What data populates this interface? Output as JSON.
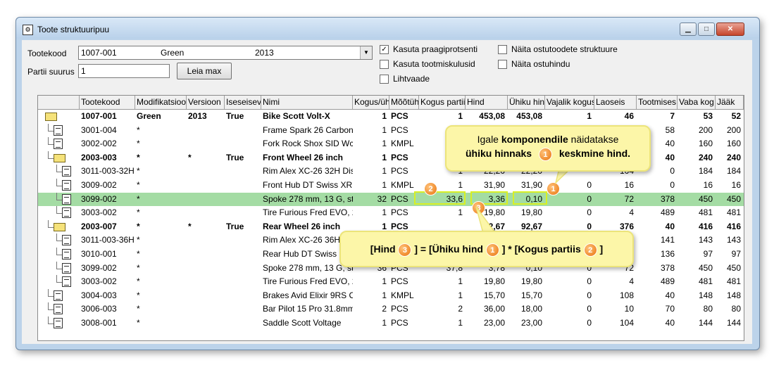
{
  "window": {
    "title": "Toote struktuuripuu",
    "icon": "gear-grid-icon"
  },
  "form": {
    "tootekood_label": "Tootekood",
    "tootekood_value": "1007-001",
    "modification": "Green",
    "version": "2013",
    "partii_label": "Partii suurus",
    "partii_value": "1",
    "find_button": "Leia max"
  },
  "options": [
    {
      "label": "Kasuta praagiprotsenti",
      "checked": true
    },
    {
      "label": "Kasuta tootmiskulusid",
      "checked": false
    },
    {
      "label": "Lihtvaade",
      "checked": false
    },
    {
      "label": "Näita ostutoodete struktuure",
      "checked": false
    },
    {
      "label": "Näita ostuhindu",
      "checked": false
    }
  ],
  "columns": [
    "Tootekood",
    "Modifikatsioo",
    "Versioon",
    "Iseseisev",
    "Nimi",
    "Kogus/üh",
    "Mõõtüh",
    "Kogus partii",
    "Hind",
    "Ühiku hin",
    "Vajalik kogus",
    "Laoseis",
    "Tootmises",
    "Vaba kog",
    "Jääk"
  ],
  "rows": [
    {
      "level": 0,
      "type": "folder",
      "bold": true,
      "code": "1007-001",
      "mod": "Green",
      "ver": "2013",
      "ind": "True",
      "name": "Bike Scott Volt-X",
      "qty": "1",
      "unit": "PCS",
      "batch": "1",
      "price": "453,08",
      "unitprice": "453,08",
      "needed": "1",
      "stock": "46",
      "prod": "7",
      "free": "53",
      "rest": "52"
    },
    {
      "level": 1,
      "type": "doc",
      "bold": false,
      "code": "3001-004",
      "mod": "*",
      "ver": "",
      "ind": "",
      "name": "Frame Spark 26 Carbon,",
      "qty": "1",
      "unit": "PCS",
      "batch": "",
      "price": "",
      "unitprice": "",
      "needed": "",
      "stock": "",
      "prod": "58",
      "free": "200",
      "rest": "200"
    },
    {
      "level": 1,
      "type": "doc",
      "bold": false,
      "code": "3002-002",
      "mod": "*",
      "ver": "",
      "ind": "",
      "name": "Fork Rock Shox SID Wc",
      "qty": "1",
      "unit": "KMPL",
      "batch": "",
      "price": "",
      "unitprice": "",
      "needed": "",
      "stock": "",
      "prod": "40",
      "free": "160",
      "rest": "160"
    },
    {
      "level": 1,
      "type": "folder",
      "bold": true,
      "code": "2003-003",
      "mod": "*",
      "ver": "*",
      "ind": "True",
      "name": "Front Wheel 26 inch",
      "qty": "1",
      "unit": "PCS",
      "batch": "",
      "price": "",
      "unitprice": "",
      "needed": "",
      "stock": "",
      "prod": "40",
      "free": "240",
      "rest": "240"
    },
    {
      "level": 2,
      "type": "doc",
      "bold": false,
      "code": "3011-003-32H",
      "mod": "*",
      "ver": "",
      "ind": "",
      "name": "Rim Alex XC-26 32H Disc",
      "qty": "1",
      "unit": "PCS",
      "batch": "1",
      "price": "22,20",
      "unitprice": "22,20",
      "needed": "",
      "stock": "104",
      "prod": "0",
      "free": "184",
      "rest": "184"
    },
    {
      "level": 2,
      "type": "doc",
      "bold": false,
      "code": "3009-002",
      "mod": "*",
      "ver": "",
      "ind": "",
      "name": "Front Hub DT Swiss XR",
      "qty": "1",
      "unit": "KMPL",
      "batch": "1",
      "price": "31,90",
      "unitprice": "31,90",
      "needed": "0",
      "stock": "16",
      "prod": "0",
      "free": "16",
      "rest": "16"
    },
    {
      "level": 2,
      "type": "doc",
      "bold": false,
      "hl": true,
      "code": "3099-002",
      "mod": "*",
      "ver": "",
      "ind": "",
      "name": "Spoke 278 mm, 13 G, sta",
      "qty": "32",
      "unit": "PCS",
      "batch": "33,6",
      "price": "3,36",
      "unitprice": "0,10",
      "needed": "0",
      "stock": "72",
      "prod": "378",
      "free": "450",
      "rest": "450"
    },
    {
      "level": 2,
      "type": "doc",
      "bold": false,
      "code": "3003-002",
      "mod": "*",
      "ver": "",
      "ind": "",
      "name": "Tire Furious Fred EVO, 2",
      "qty": "1",
      "unit": "PCS",
      "batch": "1",
      "price": "19,80",
      "unitprice": "19,80",
      "needed": "0",
      "stock": "4",
      "prod": "489",
      "free": "481",
      "rest": "481"
    },
    {
      "level": 1,
      "type": "folder",
      "bold": true,
      "code": "2003-007",
      "mod": "*",
      "ver": "*",
      "ind": "True",
      "name": "Rear Wheel 26 inch",
      "qty": "1",
      "unit": "PCS",
      "batch": "",
      "price": "92,67",
      "unitprice": "92,67",
      "needed": "0",
      "stock": "376",
      "prod": "40",
      "free": "416",
      "rest": "416"
    },
    {
      "level": 2,
      "type": "doc",
      "bold": false,
      "code": "3011-003-36H",
      "mod": "*",
      "ver": "",
      "ind": "",
      "name": "Rim Alex XC-26 36H",
      "qty": "",
      "unit": "",
      "batch": "",
      "price": "",
      "unitprice": "",
      "needed": "",
      "stock": "",
      "prod": "141",
      "free": "143",
      "rest": "143"
    },
    {
      "level": 2,
      "type": "doc",
      "bold": false,
      "code": "3010-001",
      "mod": "*",
      "ver": "",
      "ind": "",
      "name": "Rear Hub DT Swiss",
      "qty": "",
      "unit": "",
      "batch": "",
      "price": "",
      "unitprice": "",
      "needed": "",
      "stock": "",
      "prod": "136",
      "free": "97",
      "rest": "97"
    },
    {
      "level": 2,
      "type": "doc",
      "bold": false,
      "code": "3099-002",
      "mod": "*",
      "ver": "",
      "ind": "",
      "name": "Spoke 278 mm, 13 G, sta",
      "qty": "36",
      "unit": "PCS",
      "batch": "37,8",
      "price": "3,78",
      "unitprice": "0,10",
      "needed": "0",
      "stock": "72",
      "prod": "378",
      "free": "450",
      "rest": "450"
    },
    {
      "level": 2,
      "type": "doc",
      "bold": false,
      "code": "3003-002",
      "mod": "*",
      "ver": "",
      "ind": "",
      "name": "Tire Furious Fred EVO, 2",
      "qty": "1",
      "unit": "PCS",
      "batch": "1",
      "price": "19,80",
      "unitprice": "19,80",
      "needed": "0",
      "stock": "4",
      "prod": "489",
      "free": "481",
      "rest": "481"
    },
    {
      "level": 1,
      "type": "doc",
      "bold": false,
      "code": "3004-003",
      "mod": "*",
      "ver": "",
      "ind": "",
      "name": "Brakes Avid Elixir 9RS C",
      "qty": "1",
      "unit": "KMPL",
      "batch": "1",
      "price": "15,70",
      "unitprice": "15,70",
      "needed": "0",
      "stock": "108",
      "prod": "40",
      "free": "148",
      "rest": "148"
    },
    {
      "level": 1,
      "type": "doc",
      "bold": false,
      "code": "3006-003",
      "mod": "*",
      "ver": "",
      "ind": "",
      "name": "Bar Pilot 15 Pro 31.8mm",
      "qty": "2",
      "unit": "PCS",
      "batch": "2",
      "price": "36,00",
      "unitprice": "18,00",
      "needed": "0",
      "stock": "10",
      "prod": "70",
      "free": "80",
      "rest": "80"
    },
    {
      "level": 1,
      "type": "doc",
      "bold": false,
      "code": "3008-001",
      "mod": "*",
      "ver": "",
      "ind": "",
      "name": "Saddle Scott Voltage",
      "qty": "1",
      "unit": "PCS",
      "batch": "1",
      "price": "23,00",
      "unitprice": "23,00",
      "needed": "0",
      "stock": "104",
      "prod": "40",
      "free": "144",
      "rest": "144"
    }
  ],
  "callout1": {
    "line1_a": "Igale ",
    "line1_b": "komponendile",
    "line1_c": "  näidatakse",
    "line2_a": "ühiku hinnaks",
    "badge": "1",
    "line2_b": "keskmine hind."
  },
  "callout2": {
    "p1": "[Hind ",
    "b3": "3",
    "p2": " ] = [Ühiku hind ",
    "b1": "1",
    "p3": " ] * [Kogus partiis ",
    "b2": "2",
    "p4": " ]"
  },
  "markers": {
    "m1": "1",
    "m2": "2",
    "m3": "3"
  },
  "colors": {
    "highlight_row": "#a4dca4",
    "marker": "#e9730c",
    "callout_bg": "#fcf6a8",
    "outline": "#d8f024"
  }
}
